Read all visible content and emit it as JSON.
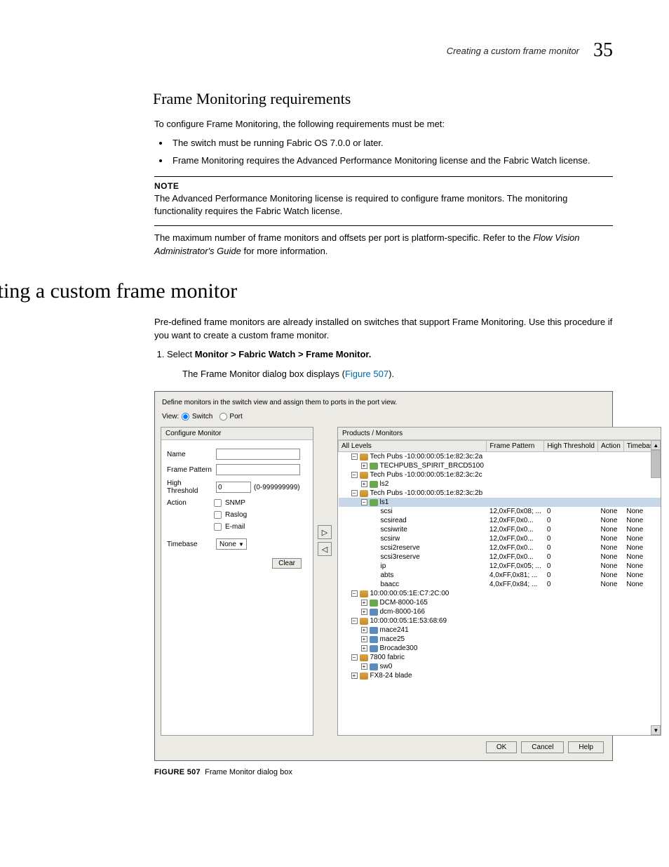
{
  "header": {
    "running_title": "Creating a custom frame monitor",
    "chapter_number": "35"
  },
  "sec_req": {
    "heading": "Frame Monitoring requirements",
    "intro": "To configure Frame Monitoring, the following requirements must be met:",
    "bullets": [
      "The switch must be running Fabric OS 7.0.0 or later.",
      "Frame Monitoring requires the Advanced Performance Monitoring license and the Fabric Watch license."
    ],
    "note_label": "NOTE",
    "note_body": "The Advanced Performance Monitoring license is required to configure frame monitors. The monitoring functionality requires the Fabric Watch license.",
    "max_pre": "The maximum number of frame monitors and offsets per port is platform-specific. Refer to the ",
    "max_ital": "Flow Vision Administrator's Guide",
    "max_post": " for more information."
  },
  "sec_create": {
    "heading": "Creating a custom frame monitor",
    "intro": "Pre-defined frame monitors are already installed on switches that support Frame Monitoring. Use this procedure if you want to create a custom frame monitor.",
    "step1_pre": "Select ",
    "step1_bold": "Monitor > Fabric Watch > Frame Monitor.",
    "step1_after_pre": "The Frame Monitor dialog box displays (",
    "step1_after_link": "Figure 507",
    "step1_after_post": ")."
  },
  "dialog": {
    "instruction": "Define monitors in the switch view and assign them to ports in the port view.",
    "view_label": "View:",
    "radio_switch": "Switch",
    "radio_port": "Port",
    "left_title": "Configure Monitor",
    "form": {
      "name_lbl": "Name",
      "frame_lbl": "Frame Pattern",
      "high_lbl": "High Threshold",
      "high_val": "0",
      "high_range": "(0-999999999)",
      "action_lbl": "Action",
      "chk_snmp": "SNMP",
      "chk_raslog": "Raslog",
      "chk_email": "E-mail",
      "time_lbl": "Timebase",
      "time_val": "None",
      "clear": "Clear"
    },
    "right_title": "Products / Monitors",
    "cols": {
      "c1": "All Levels",
      "c2": "Frame Pattern",
      "c3": "High Threshold",
      "c4": "Action",
      "c5": "Timebase"
    },
    "rows": [
      {
        "d": 0,
        "exp": "-",
        "ic": "fab",
        "name": "Tech Pubs -10:00:00:05:1e:82:3c:2a"
      },
      {
        "d": 1,
        "exp": "+",
        "ic": "grp",
        "name": "TECHPUBS_SPIRIT_BRCD5100"
      },
      {
        "d": 0,
        "exp": "-",
        "ic": "fab",
        "name": "Tech Pubs -10:00:00:05:1e:82:3c:2c"
      },
      {
        "d": 1,
        "exp": "+",
        "ic": "grp",
        "name": "ls2"
      },
      {
        "d": 0,
        "exp": "-",
        "ic": "fab",
        "name": "Tech Pubs -10:00:00:05:1e:82:3c:2b"
      },
      {
        "d": 1,
        "exp": "-",
        "ic": "grp",
        "name": "ls1",
        "sel": true
      },
      {
        "d": 2,
        "name": "scsi",
        "fp": "12,0xFF,0x08; ...",
        "ht": "0",
        "ac": "None",
        "tb": "None"
      },
      {
        "d": 2,
        "name": "scsiread",
        "fp": "12,0xFF,0x0...",
        "ht": "0",
        "ac": "None",
        "tb": "None"
      },
      {
        "d": 2,
        "name": "scsiwrite",
        "fp": "12,0xFF,0x0...",
        "ht": "0",
        "ac": "None",
        "tb": "None"
      },
      {
        "d": 2,
        "name": "scsirw",
        "fp": "12,0xFF,0x0...",
        "ht": "0",
        "ac": "None",
        "tb": "None"
      },
      {
        "d": 2,
        "name": "scsi2reserve",
        "fp": "12,0xFF,0x0...",
        "ht": "0",
        "ac": "None",
        "tb": "None"
      },
      {
        "d": 2,
        "name": "scsi3reserve",
        "fp": "12,0xFF,0x0...",
        "ht": "0",
        "ac": "None",
        "tb": "None"
      },
      {
        "d": 2,
        "name": "ip",
        "fp": "12,0xFF,0x05; ...",
        "ht": "0",
        "ac": "None",
        "tb": "None"
      },
      {
        "d": 2,
        "name": "abts",
        "fp": "4,0xFF,0x81; ...",
        "ht": "0",
        "ac": "None",
        "tb": "None"
      },
      {
        "d": 2,
        "name": "baacc",
        "fp": "4,0xFF,0x84; ...",
        "ht": "0",
        "ac": "None",
        "tb": "None"
      },
      {
        "d": 0,
        "exp": "-",
        "ic": "fab",
        "name": "10:00:00:05:1E:C7:2C:00"
      },
      {
        "d": 1,
        "exp": "+",
        "ic": "grp",
        "name": "DCM-8000-165"
      },
      {
        "d": 1,
        "exp": "+",
        "ic": "sw",
        "name": "dcm-8000-166"
      },
      {
        "d": 0,
        "exp": "-",
        "ic": "fab",
        "name": "10:00:00:05:1E:53:68:69"
      },
      {
        "d": 1,
        "exp": "+",
        "ic": "sw",
        "name": "mace241"
      },
      {
        "d": 1,
        "exp": "+",
        "ic": "sw",
        "name": "mace25"
      },
      {
        "d": 1,
        "exp": "+",
        "ic": "sw",
        "name": "Brocade300"
      },
      {
        "d": 0,
        "exp": "-",
        "ic": "fab",
        "name": "7800 fabric"
      },
      {
        "d": 1,
        "exp": "+",
        "ic": "sw",
        "name": "sw0"
      },
      {
        "d": 0,
        "exp": "+",
        "ic": "fab",
        "name": "FX8-24 blade"
      }
    ],
    "buttons": {
      "ok": "OK",
      "cancel": "Cancel",
      "help": "Help"
    }
  },
  "figure": {
    "label": "FIGURE 507",
    "caption": "Frame Monitor dialog box"
  }
}
